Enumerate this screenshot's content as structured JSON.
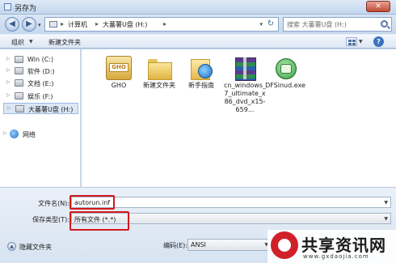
{
  "window": {
    "title": "另存为",
    "close_label": "✕"
  },
  "address": {
    "crumbs": [
      "计算机",
      "大蕃薯U盘 (H:)"
    ],
    "search_placeholder": "搜索 大蕃薯U盘 (H:)"
  },
  "toolbar": {
    "organize": "组织",
    "new_folder": "新建文件夹",
    "help": "?"
  },
  "nav_tree": [
    {
      "label": "Win (C:)"
    },
    {
      "label": "软件 (D:)"
    },
    {
      "label": "文档 (E:)"
    },
    {
      "label": "娱乐 (F:)"
    },
    {
      "label": "大蕃薯U盘 (H:)",
      "selected": true
    },
    {
      "label": "网络"
    }
  ],
  "files": [
    {
      "name": "GHO",
      "icon": "ghost-icon"
    },
    {
      "name": "新建文件夹",
      "icon": "folder-icon"
    },
    {
      "name": "新手指南",
      "icon": "folder-icon"
    },
    {
      "name": "cn_windows_7_ultimate_x86_dvd_x15-659...",
      "icon": "archive-icon"
    },
    {
      "name": "DFSinud.exe",
      "icon": "exe-icon"
    }
  ],
  "form": {
    "filename_label": "文件名(N):",
    "filename_value": "autorun.inf",
    "filetype_label": "保存类型(T):",
    "filetype_value": "所有文件 (*.*)",
    "hide_folders": "隐藏文件夹",
    "encoding_label": "编码(E):",
    "encoding_value": "ANSI"
  },
  "watermark": {
    "title": "共享资讯网",
    "subtitle": "www.gxdaojia.com"
  },
  "colors": {
    "highlight": "#d2191d",
    "title_bar": "#c3d6ee"
  }
}
